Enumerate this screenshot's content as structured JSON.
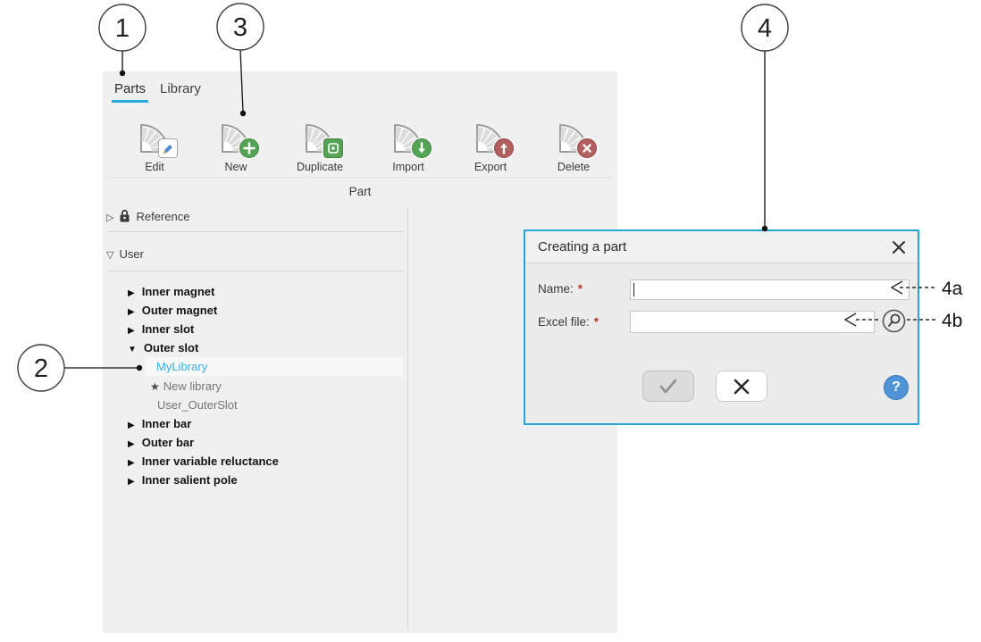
{
  "colors": {
    "accent_blue": "#29abe2",
    "selected_item_text": "#3daee2",
    "dialog_border": "#2aa5d8",
    "badge_green": "#55a455",
    "badge_red": "#b15f5f",
    "pencil_blue": "#4a90d2",
    "help_blue": "#4f94d6",
    "required_red": "#b03a2e"
  },
  "callouts": {
    "n1": "1",
    "n2": "2",
    "n3": "3",
    "n4": "4",
    "n4a": "4a",
    "n4b": "4b"
  },
  "panel": {
    "tabs": [
      {
        "label": "Parts"
      },
      {
        "label": "Library"
      }
    ],
    "toolbar": {
      "buttons": [
        {
          "label": "Edit",
          "badge_icon": "pencil-icon"
        },
        {
          "label": "New",
          "badge_icon": "plus-icon"
        },
        {
          "label": "Duplicate",
          "badge_icon": "copy-icon"
        },
        {
          "label": "Import",
          "badge_icon": "arrow-down-icon"
        },
        {
          "label": "Export",
          "badge_icon": "arrow-up-icon"
        },
        {
          "label": "Delete",
          "badge_icon": "cross-icon"
        }
      ],
      "group_label": "Part"
    },
    "tree": {
      "sections": [
        {
          "label": "Reference",
          "arrow": "▷",
          "locked": true
        },
        {
          "label": "User",
          "arrow": "▽",
          "locked": false
        }
      ],
      "items": [
        {
          "label": "Inner magnet",
          "arrow": "▶"
        },
        {
          "label": "Outer magnet",
          "arrow": "▶"
        },
        {
          "label": "Inner slot",
          "arrow": "▶"
        },
        {
          "label": "Outer slot",
          "arrow": "▼"
        },
        {
          "label": "MyLibrary",
          "selected": true
        },
        {
          "label": "New library",
          "star": "★"
        },
        {
          "label": "User_OuterSlot"
        },
        {
          "label": "Inner bar",
          "arrow": "▶"
        },
        {
          "label": "Outer bar",
          "arrow": "▶"
        },
        {
          "label": "Inner variable reluctance",
          "arrow": "▶"
        },
        {
          "label": "Inner salient pole",
          "arrow": "▶"
        }
      ]
    }
  },
  "dialog": {
    "title": "Creating a part",
    "fields": [
      {
        "label": "Name:",
        "required": "*",
        "value": ""
      },
      {
        "label": "Excel file:",
        "required": "*",
        "value": ""
      }
    ]
  }
}
